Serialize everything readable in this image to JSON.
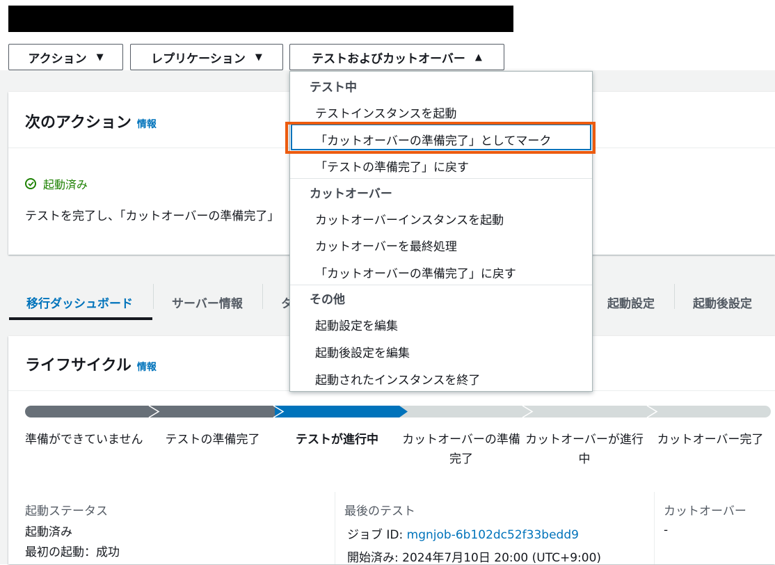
{
  "action_buttons": {
    "actions": "アクション",
    "replication": "レプリケーション",
    "test_cutover": "テストおよびカットオーバー",
    "caret_down": "▼",
    "caret_up": "▲"
  },
  "next_action": {
    "title": "次のアクション",
    "info": "情報",
    "status": "起動済み",
    "description": "テストを完了し、「カットオーバーの準備完了」"
  },
  "tabs": [
    "移行ダッシュボード",
    "サーバー情報",
    "タ",
    "起動設定",
    "起動後設定"
  ],
  "lifecycle": {
    "title": "ライフサイクル",
    "info": "情報",
    "steps": [
      "準備ができていません",
      "テストの準備完了",
      "テストが進行中",
      "カットオーバーの準備完了",
      "カットオーバーが進行中",
      "カットオーバー完了"
    ],
    "step_lines": [
      [
        "準備ができていません"
      ],
      [
        "テストの準備完了"
      ],
      [
        "テストが進行中"
      ],
      [
        "カットオーバーの準備",
        "完了"
      ],
      [
        "カットオーバーが進行",
        "中"
      ],
      [
        "カットオーバー完了"
      ]
    ]
  },
  "details": {
    "launch_status_label": "起動ステータス",
    "launch_status_value": "起動済み",
    "first_launch": "最初の起動：成功",
    "last_test_label": "最後のテスト",
    "job_id_label": "ジョブ ID:",
    "job_id_value": "mgnjob-6b102dc52f33bedd9",
    "started_label": "開始済み:",
    "started_value": "2024年7月10日 20:00 (UTC+9:00)",
    "cutover_label": "カットオーバー",
    "cutover_value": "-"
  },
  "dropdown": {
    "groups": [
      {
        "label": "テスト中",
        "items": [
          "テストインスタンスを起動",
          "「カットオーバーの準備完了」としてマーク",
          "「テストの準備完了」に戻す"
        ]
      },
      {
        "label": "カットオーバー",
        "items": [
          "カットオーバーインスタンスを起動",
          "カットオーバーを最終処理",
          "「カットオーバーの準備完了」に戻す"
        ]
      },
      {
        "label": "その他",
        "items": [
          "起動設定を編集",
          "起動後設定を編集",
          "起動されたインスタンスを終了"
        ]
      }
    ]
  },
  "colors": {
    "primary": "#0073bb",
    "completed_step": "#687078",
    "pending_step": "#d5dbdb",
    "success": "#1d8102",
    "highlight_border": "#ec5b0f"
  }
}
